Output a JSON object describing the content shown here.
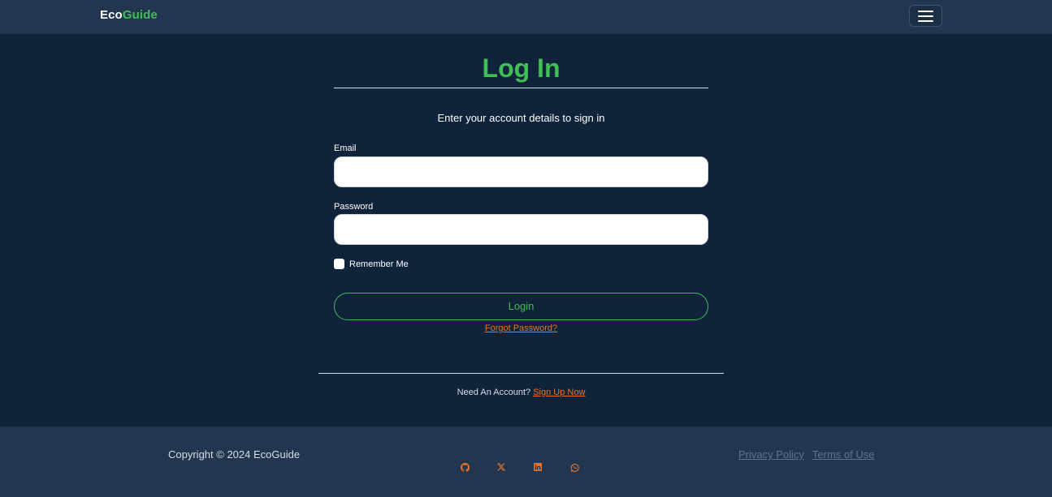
{
  "header": {
    "brand_part1": "Eco",
    "brand_part2": "Guide",
    "menu_icon": "hamburger-icon"
  },
  "login": {
    "title": "Log In",
    "subtitle": "Enter your account details to sign in",
    "email_label": "Email",
    "email_value": "",
    "password_label": "Password",
    "password_value": "",
    "remember_label": "Remember Me",
    "remember_checked": false,
    "login_button": "Login",
    "forgot_link": "Forgot Password?",
    "signup_prompt": "Need An Account?",
    "signup_link": "Sign Up Now"
  },
  "footer": {
    "copyright": "Copyright © 2024 EcoGuide",
    "social": [
      "github-icon",
      "x-icon",
      "linkedin-icon",
      "whatsapp-icon"
    ],
    "links": [
      "Privacy Policy",
      "Terms of Use"
    ]
  },
  "colors": {
    "background": "#0f233a",
    "header_bg": "#22364f",
    "accent_green": "#3fbf55",
    "accent_orange": "#e8742c"
  }
}
